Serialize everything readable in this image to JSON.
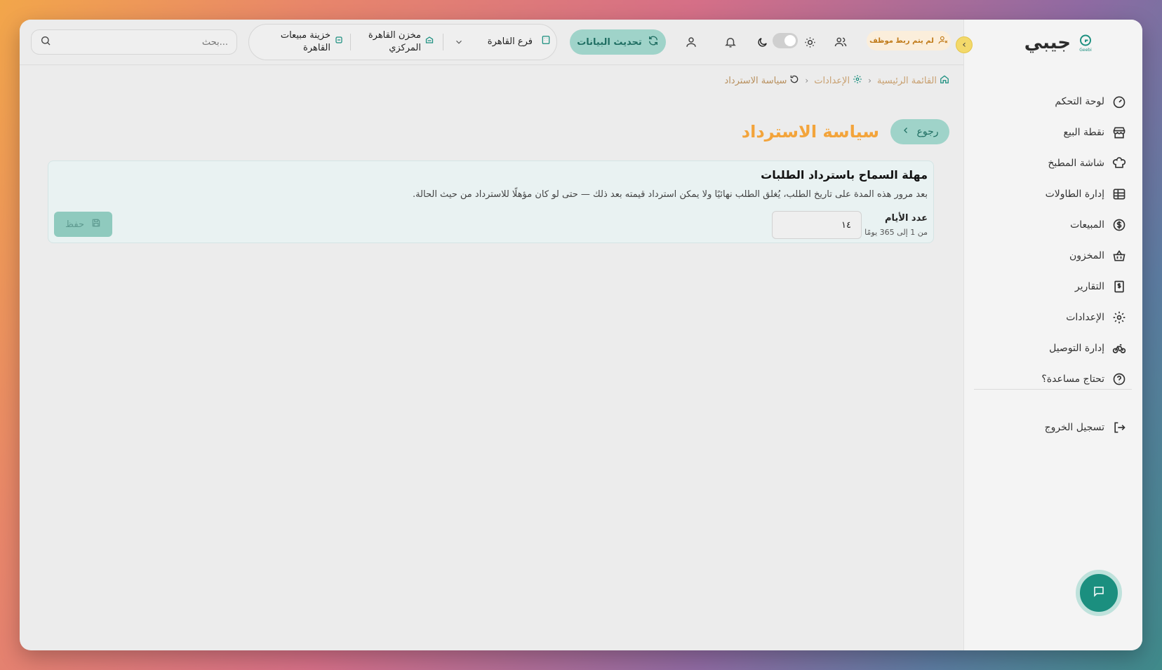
{
  "brand": {
    "name": "جيبي",
    "logo_text": "Geebi"
  },
  "sidebar": {
    "items": [
      {
        "label": "لوحة التحكم",
        "icon": "gauge-icon"
      },
      {
        "label": "نقطة البيع",
        "icon": "store-icon"
      },
      {
        "label": "شاشة المطبخ",
        "icon": "chef-hat-icon"
      },
      {
        "label": "إدارة الطاولات",
        "icon": "table-grid-icon"
      },
      {
        "label": "المبيعات",
        "icon": "dollar-circle-icon"
      },
      {
        "label": "المخزون",
        "icon": "basket-icon"
      },
      {
        "label": "التقارير",
        "icon": "receipt-icon"
      },
      {
        "label": "الإعدادات",
        "icon": "gear-icon"
      },
      {
        "label": "إدارة التوصيل",
        "icon": "bike-icon"
      },
      {
        "label": "تحتاج مساعدة؟",
        "icon": "help-circle-icon"
      }
    ],
    "logout_label": "تسجيل الخروج"
  },
  "topbar": {
    "search_placeholder": "بحث...",
    "cashbox": "خزينة مبيعات القاهرة",
    "warehouse": "مخزن القاهرة المركزي",
    "branch": "فرع القاهرة",
    "refresh_label": "تحديث البيانات",
    "employee_badge": "لم يتم ربط موظف"
  },
  "breadcrumb": {
    "home": "القائمة الرئيسية",
    "settings": "الإعدادات",
    "current": "سياسة الاسترداد"
  },
  "page": {
    "back_label": "رجوع",
    "title": "سياسة الاسترداد"
  },
  "card": {
    "title": "مهلة السماح باسترداد الطلبات",
    "description": "بعد مرور هذه المدة على تاريخ الطلب، يُغلق الطلب نهائيًا ولا يمكن استرداد قيمته بعد ذلك — حتى لو كان مؤهلًا للاسترداد من حيث الحالة.",
    "field_label": "عدد الأيام",
    "field_hint": "من 1 إلى 365 يومًا",
    "days_value": "١٤",
    "save_label": "حفظ"
  },
  "colors": {
    "accent": "#f3a43b",
    "primary": "#1b8f7f",
    "primary_soft": "#9fd3c9"
  }
}
